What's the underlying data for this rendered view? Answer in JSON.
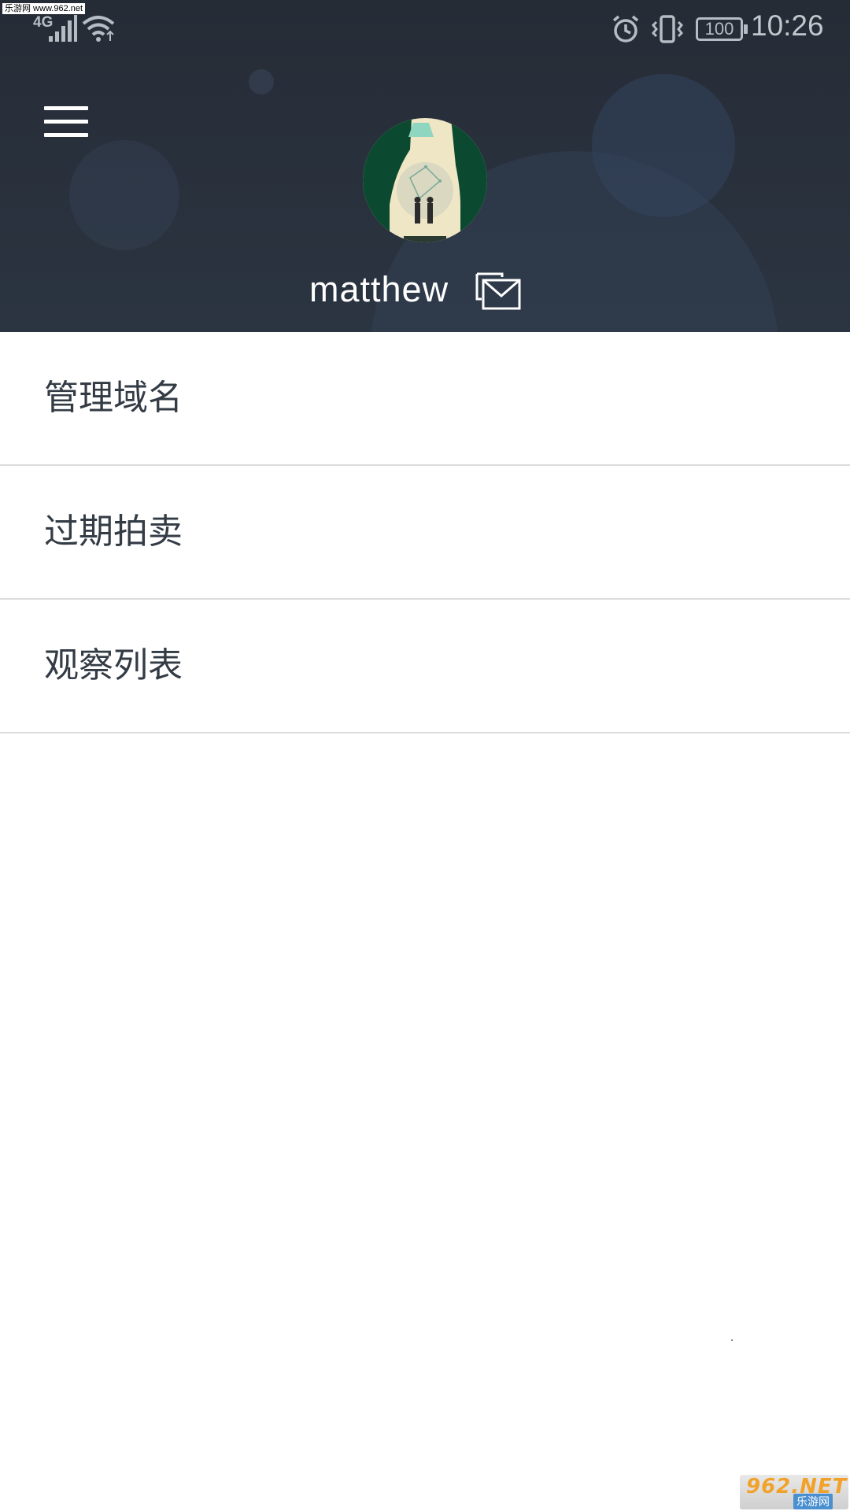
{
  "watermark_top": "乐游网 www.962.net",
  "status_bar": {
    "network": "4G",
    "battery": "100",
    "time": "10:26",
    "icons": [
      "signal-icon",
      "wifi-icon",
      "alarm-icon",
      "vibrate-icon",
      "battery-icon"
    ]
  },
  "header": {
    "menu_icon": "hamburger-menu-icon",
    "username": "matthew",
    "mail_icon": "mail-icon",
    "background_color": "#262c36"
  },
  "menu": {
    "items": [
      {
        "label": "管理域名"
      },
      {
        "label": "过期拍卖"
      },
      {
        "label": "观察列表"
      }
    ]
  },
  "watermark_bottom": {
    "main": "962.NET",
    "sub": "乐游网"
  },
  "colors": {
    "text": "#333b45",
    "divider": "#dcdcdc",
    "header": "#262c36"
  }
}
